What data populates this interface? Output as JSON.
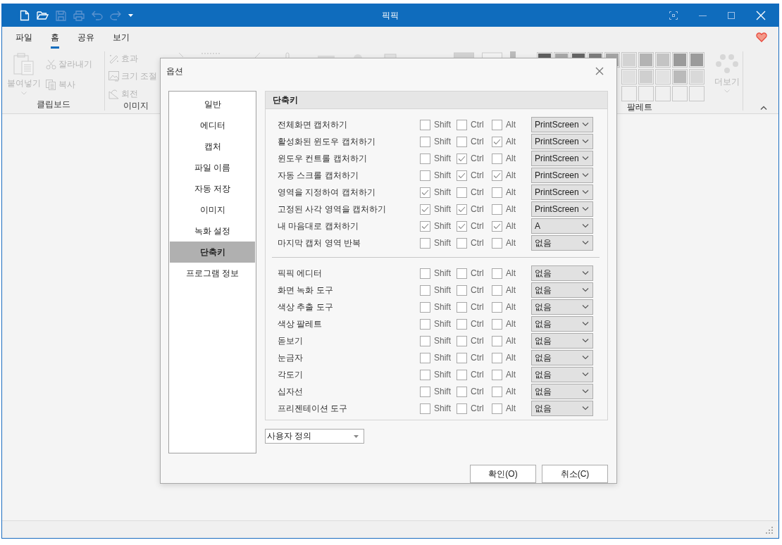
{
  "window": {
    "title": "픽픽"
  },
  "ribbon": {
    "tabs": [
      {
        "label": "파일",
        "selected": false
      },
      {
        "label": "홈",
        "selected": true
      },
      {
        "label": "공유",
        "selected": false
      },
      {
        "label": "보기",
        "selected": false
      }
    ],
    "clipboard": {
      "label": "클립보드",
      "paste": {
        "label": "붙여넣기",
        "disabled": true
      },
      "items": [
        {
          "label": "잘라내기",
          "disabled": true
        },
        {
          "label": "복사",
          "disabled": true
        }
      ]
    },
    "image": {
      "label": "이미지",
      "items": [
        {
          "label": "효과",
          "disabled": true
        },
        {
          "label": "크기 조절",
          "disabled": true
        },
        {
          "label": "회전",
          "disabled": true
        }
      ]
    },
    "palette": {
      "label": "팔레트",
      "more": "더보기",
      "rows": [
        [
          {
            "color": "#5f5f5f"
          },
          {
            "color": "#a8a8a8"
          },
          {
            "color": "#666666"
          },
          {
            "color": "#7d7d7d"
          },
          {
            "color": "#a6a6a6"
          },
          {
            "color": "#d3d3d3"
          },
          {
            "color": "#b3b3b3"
          },
          {
            "color": "#c4c4c4"
          },
          {
            "color": "#9a9a9a"
          },
          {
            "color": "#9b9b9b"
          }
        ],
        [
          {
            "color": "#e0e0e0"
          },
          {
            "color": "#cfcfcf"
          },
          {
            "color": "#e2e2e2"
          },
          {
            "color": "#bababa"
          },
          {
            "color": "#d9d9d9"
          }
        ],
        [
          {
            "color": "#f0f0f0"
          },
          {
            "color": "#f0f0f0"
          },
          {
            "color": "#f0f0f0"
          },
          {
            "color": "#f0f0f0"
          },
          {
            "color": "#f0f0f0"
          }
        ]
      ]
    }
  },
  "dialog": {
    "title": "옵션",
    "nav": [
      {
        "label": "일반",
        "selected": false
      },
      {
        "label": "에디터",
        "selected": false
      },
      {
        "label": "캡처",
        "selected": false
      },
      {
        "label": "파일 이름",
        "selected": false
      },
      {
        "label": "자동 저장",
        "selected": false
      },
      {
        "label": "이미지",
        "selected": false
      },
      {
        "label": "녹화 설정",
        "selected": false
      },
      {
        "label": "단축키",
        "selected": true
      },
      {
        "label": "프로그램 정보",
        "selected": false
      }
    ],
    "section": "단축키",
    "groups": [
      [
        {
          "name": "전체화면 캡처하기",
          "mods": [
            {
              "label": "Shift",
              "checked": false
            },
            {
              "label": "Ctrl",
              "checked": false
            },
            {
              "label": "Alt",
              "checked": false
            }
          ],
          "key": "PrintScreen"
        },
        {
          "name": "활성화된 윈도우 캡처하기",
          "mods": [
            {
              "label": "Shift",
              "checked": false
            },
            {
              "label": "Ctrl",
              "checked": false
            },
            {
              "label": "Alt",
              "checked": true
            }
          ],
          "key": "PrintScreen"
        },
        {
          "name": "윈도우 컨트롤 캡처하기",
          "mods": [
            {
              "label": "Shift",
              "checked": false
            },
            {
              "label": "Ctrl",
              "checked": true
            },
            {
              "label": "Alt",
              "checked": false
            }
          ],
          "key": "PrintScreen"
        },
        {
          "name": "자동 스크롤 캡처하기",
          "mods": [
            {
              "label": "Shift",
              "checked": false
            },
            {
              "label": "Ctrl",
              "checked": true
            },
            {
              "label": "Alt",
              "checked": true
            }
          ],
          "key": "PrintScreen"
        },
        {
          "name": "영역을 지정하여 캡처하기",
          "mods": [
            {
              "label": "Shift",
              "checked": true
            },
            {
              "label": "Ctrl",
              "checked": false
            },
            {
              "label": "Alt",
              "checked": false
            }
          ],
          "key": "PrintScreen"
        },
        {
          "name": "고정된 사각 영역을 캡처하기",
          "mods": [
            {
              "label": "Shift",
              "checked": true
            },
            {
              "label": "Ctrl",
              "checked": true
            },
            {
              "label": "Alt",
              "checked": false
            }
          ],
          "key": "PrintScreen"
        },
        {
          "name": "내 마음대로 캡처하기",
          "mods": [
            {
              "label": "Shift",
              "checked": true
            },
            {
              "label": "Ctrl",
              "checked": true
            },
            {
              "label": "Alt",
              "checked": true
            }
          ],
          "key": "A"
        },
        {
          "name": "마지막 캡처 영역 반복",
          "mods": [
            {
              "label": "Shift",
              "checked": false
            },
            {
              "label": "Ctrl",
              "checked": false
            },
            {
              "label": "Alt",
              "checked": false
            }
          ],
          "key": "없음"
        }
      ],
      [
        {
          "name": "픽픽 에디터",
          "mods": [
            {
              "label": "Shift",
              "checked": false
            },
            {
              "label": "Ctrl",
              "checked": false
            },
            {
              "label": "Alt",
              "checked": false
            }
          ],
          "key": "없음"
        },
        {
          "name": "화면 녹화 도구",
          "mods": [
            {
              "label": "Shift",
              "checked": false
            },
            {
              "label": "Ctrl",
              "checked": false
            },
            {
              "label": "Alt",
              "checked": false
            }
          ],
          "key": "없음"
        },
        {
          "name": "색상 추출 도구",
          "mods": [
            {
              "label": "Shift",
              "checked": false
            },
            {
              "label": "Ctrl",
              "checked": false
            },
            {
              "label": "Alt",
              "checked": false
            }
          ],
          "key": "없음"
        },
        {
          "name": "색상 팔레트",
          "mods": [
            {
              "label": "Shift",
              "checked": false
            },
            {
              "label": "Ctrl",
              "checked": false
            },
            {
              "label": "Alt",
              "checked": false
            }
          ],
          "key": "없음"
        },
        {
          "name": "돋보기",
          "mods": [
            {
              "label": "Shift",
              "checked": false
            },
            {
              "label": "Ctrl",
              "checked": false
            },
            {
              "label": "Alt",
              "checked": false
            }
          ],
          "key": "없음"
        },
        {
          "name": "눈금자",
          "mods": [
            {
              "label": "Shift",
              "checked": false
            },
            {
              "label": "Ctrl",
              "checked": false
            },
            {
              "label": "Alt",
              "checked": false
            }
          ],
          "key": "없음"
        },
        {
          "name": "각도기",
          "mods": [
            {
              "label": "Shift",
              "checked": false
            },
            {
              "label": "Ctrl",
              "checked": false
            },
            {
              "label": "Alt",
              "checked": false
            }
          ],
          "key": "없음"
        },
        {
          "name": "십자선",
          "mods": [
            {
              "label": "Shift",
              "checked": false
            },
            {
              "label": "Ctrl",
              "checked": false
            },
            {
              "label": "Alt",
              "checked": false
            }
          ],
          "key": "없음"
        },
        {
          "name": "프리젠테이션 도구",
          "mods": [
            {
              "label": "Shift",
              "checked": false
            },
            {
              "label": "Ctrl",
              "checked": false
            },
            {
              "label": "Alt",
              "checked": false
            }
          ],
          "key": "없음"
        }
      ]
    ],
    "preset": "사용자 정의",
    "buttons": [
      "확인(O)",
      "취소(C)"
    ]
  }
}
